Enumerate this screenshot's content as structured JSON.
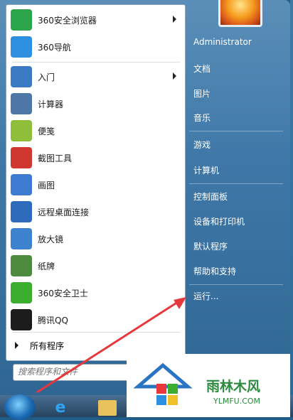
{
  "menu": {
    "items": [
      {
        "label": "360安全浏览器",
        "icon": "browser-360-icon",
        "color": "#2da54a",
        "arrow": true
      },
      {
        "label": "360导航",
        "icon": "ie-icon",
        "color": "#2c8fe0",
        "arrow": false
      },
      {
        "label": "入门",
        "icon": "getting-started-icon",
        "color": "#3a7ac2",
        "arrow": true
      },
      {
        "label": "计算器",
        "icon": "calculator-icon",
        "color": "#4c77a6",
        "arrow": false
      },
      {
        "label": "便笺",
        "icon": "sticky-notes-icon",
        "color": "#8fbf3a",
        "arrow": false
      },
      {
        "label": "截图工具",
        "icon": "snipping-tool-icon",
        "color": "#d0382f",
        "arrow": false
      },
      {
        "label": "画图",
        "icon": "paint-icon",
        "color": "#3d7bd1",
        "arrow": false
      },
      {
        "label": "远程桌面连接",
        "icon": "remote-desktop-icon",
        "color": "#2f6bbd",
        "arrow": false
      },
      {
        "label": "放大镜",
        "icon": "magnifier-icon",
        "color": "#3c82cf",
        "arrow": false
      },
      {
        "label": "纸牌",
        "icon": "solitaire-icon",
        "color": "#4c8a3e",
        "arrow": false
      },
      {
        "label": "360安全卫士",
        "icon": "security-360-icon",
        "color": "#3cae2f",
        "arrow": false
      },
      {
        "label": "腾讯QQ",
        "icon": "qq-icon",
        "color": "#1c1c1c",
        "arrow": false
      }
    ],
    "all_programs": "所有程序",
    "search_placeholder": "搜索程序和文件"
  },
  "right": {
    "user": "Administrator",
    "items": [
      "文档",
      "图片",
      "音乐",
      "游戏",
      "计算机",
      "控制面板",
      "设备和打印机",
      "默认程序",
      "帮助和支持",
      "运行..."
    ]
  },
  "watermark": {
    "text": "雨林木风",
    "sub": "YLMFU.COM"
  }
}
